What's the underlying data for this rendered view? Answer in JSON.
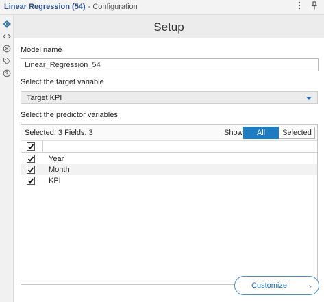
{
  "titlebar": {
    "title": "Linear Regression (54)",
    "subtitle": "- Configuration",
    "icons": [
      "more-vertical-icon",
      "pin-icon"
    ]
  },
  "leftbar": {
    "icons": [
      "gear-icon",
      "code-icon",
      "close-circle-icon",
      "tag-icon",
      "help-icon"
    ]
  },
  "setup": {
    "title": "Setup",
    "model_name_label": "Model name",
    "model_name_value": "Linear_Regression_54",
    "target_label": "Select the target variable",
    "target_value": "Target KPI",
    "predictor_label": "Select the predictor variables"
  },
  "fields": {
    "summary": "Selected: 3 Fields: 3",
    "show_label": "Show:",
    "filter_all": "All",
    "filter_selected": "Selected",
    "active_filter": "All",
    "header_checked": true,
    "rows": [
      {
        "label": "Year",
        "checked": true
      },
      {
        "label": "Month",
        "checked": true
      },
      {
        "label": "KPI",
        "checked": true
      }
    ]
  },
  "customize_button": {
    "label": "Customize",
    "chevron": "›"
  },
  "colors": {
    "accent": "#1f7cc1",
    "title_text": "#2d4f86"
  }
}
